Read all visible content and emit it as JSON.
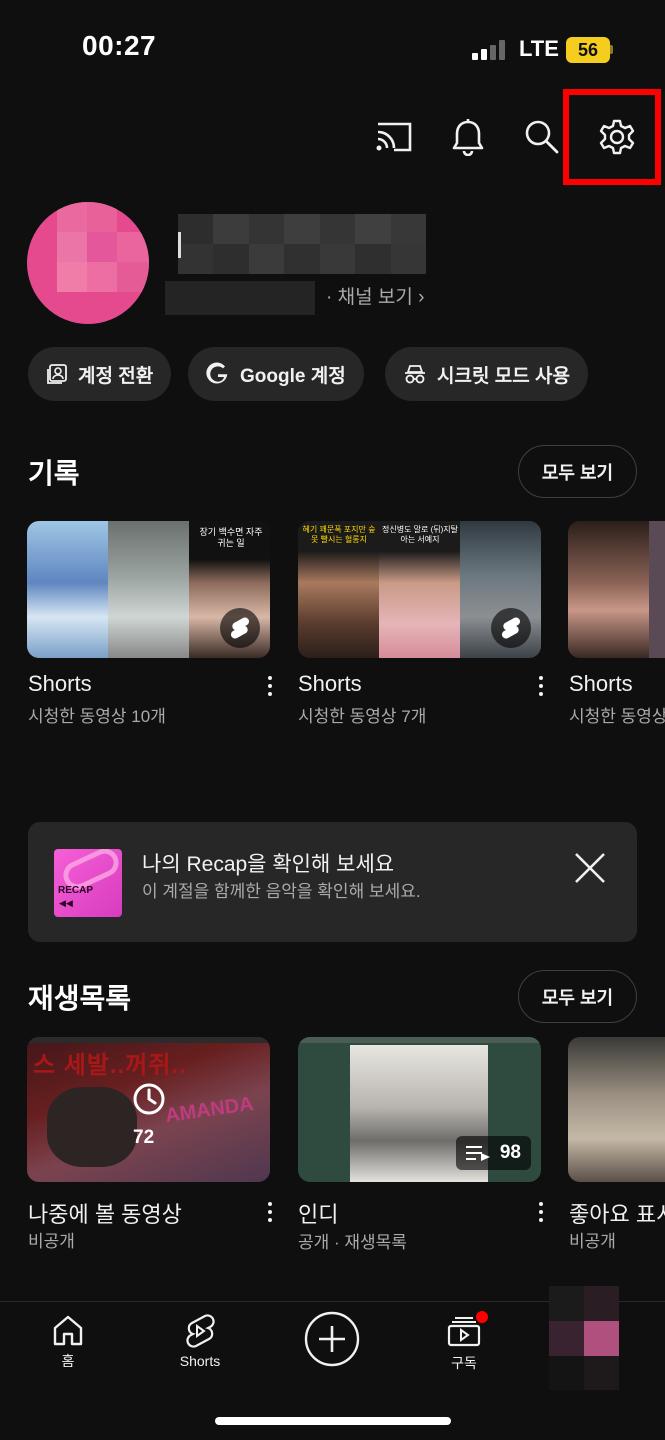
{
  "status_bar": {
    "time": "00:27",
    "network": "LTE",
    "battery": "56"
  },
  "header": {
    "icons": [
      "cast-icon",
      "bell-icon",
      "search-icon",
      "gear-icon"
    ],
    "highlight_color": "#ff0000"
  },
  "profile": {
    "channel_link": "· 채널 보기 ›"
  },
  "chips": [
    {
      "label": "계정 전환",
      "icon": "switch-account-icon"
    },
    {
      "label": "Google 계정",
      "icon": "google-icon"
    },
    {
      "label": "시크릿 모드 사용",
      "icon": "incognito-icon"
    }
  ],
  "history": {
    "title": "기록",
    "see_all": "모두 보기",
    "items": [
      {
        "title": "Shorts",
        "subtitle": "시청한 동영상 10개",
        "thumb_caption": "장기 백수면 자주 귀는 일"
      },
      {
        "title": "Shorts",
        "subtitle": "시청한 동영상 7개",
        "thumb_caption_left": "혜기 꽤문폭 포지만 숲 못 빨시는 혈롱지",
        "thumb_caption_mid": "정신병도 말로 (뒤)지탈 아는 서예지"
      },
      {
        "title": "Shorts",
        "subtitle": "시청한 동영상"
      }
    ]
  },
  "recap": {
    "title": "나의 Recap을 확인해 보세요",
    "subtitle": "이 계절을 함께한 음악을 확인해 보세요.",
    "thumb_label": "RECAP"
  },
  "playlists": {
    "title": "재생목록",
    "see_all": "모두 보기",
    "items": [
      {
        "title": "나중에 볼 동영상",
        "subtitle": "비공개",
        "count": "72",
        "thumb_text": "스 세발..꺼쥐..",
        "thumb_text2": "AMANDA"
      },
      {
        "title": "인디",
        "subtitle": "공개 · 재생목록",
        "count": "98"
      },
      {
        "title": "좋아요 표시",
        "subtitle": "비공개"
      }
    ]
  },
  "bottom_nav": {
    "home": "홈",
    "shorts": "Shorts",
    "subscriptions": "구독",
    "notification_dot_color": "#ff0000"
  }
}
